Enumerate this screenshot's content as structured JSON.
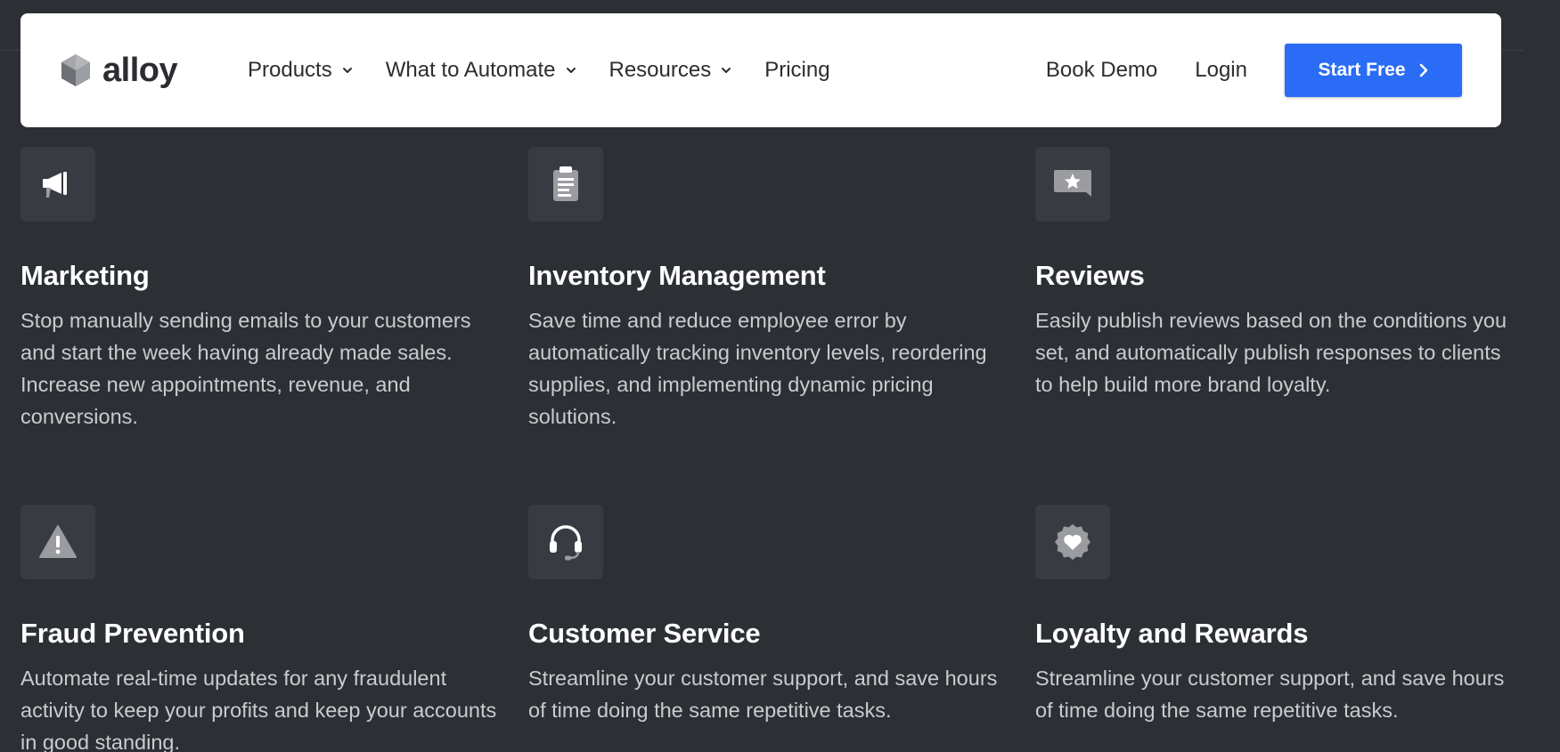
{
  "header": {
    "brand": "alloy",
    "nav": [
      {
        "label": "Products"
      },
      {
        "label": "What to Automate"
      },
      {
        "label": "Resources"
      },
      {
        "label": "Pricing"
      }
    ],
    "book_demo": "Book Demo",
    "login": "Login",
    "start_free": "Start Free"
  },
  "cards": [
    {
      "title": "Marketing",
      "icon": "megaphone-icon",
      "description": "Stop manually sending emails to your customers and start the week having already made sales. Increase new appointments, revenue, and conversions."
    },
    {
      "title": "Inventory Management",
      "icon": "clipboard-icon",
      "description": "Save time and reduce employee error by automatically tracking inventory levels, reordering supplies, and implementing dynamic pricing solutions."
    },
    {
      "title": "Reviews",
      "icon": "star-comment-icon",
      "description": "Easily publish reviews based on the conditions you set, and automatically publish responses to clients to help build more brand loyalty."
    },
    {
      "title": "Fraud Prevention",
      "icon": "warning-icon",
      "description": "Automate real-time updates for any fraudulent activity to keep your profits and keep your accounts in good standing."
    },
    {
      "title": "Customer Service",
      "icon": "headset-icon",
      "description": "Streamline your customer support, and save hours of time doing the same repetitive tasks."
    },
    {
      "title": "Loyalty and Rewards",
      "icon": "heart-badge-icon",
      "description": "Streamline your customer support, and save hours of time doing the same repetitive tasks."
    }
  ],
  "colors": {
    "background": "#2c2f34",
    "header_bg": "#ffffff",
    "primary": "#2a6cf6",
    "icon_box": "#383b41",
    "text_muted": "#c9cbcf"
  }
}
